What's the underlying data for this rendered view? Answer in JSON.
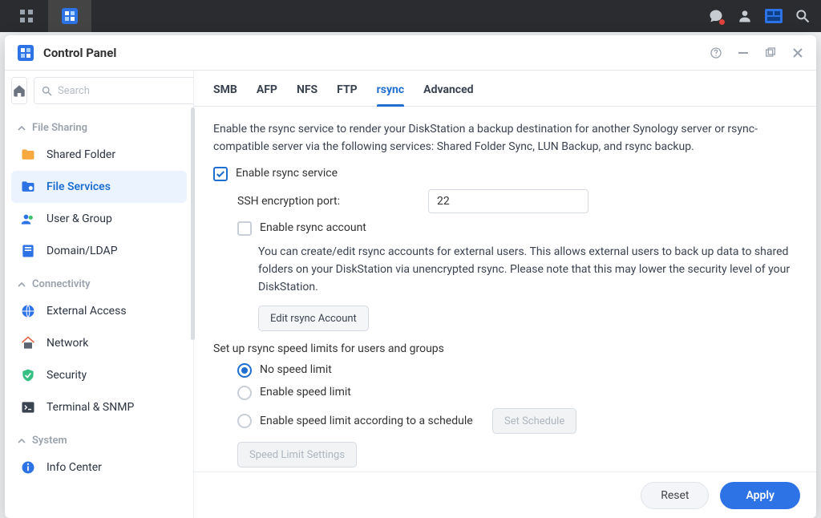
{
  "taskbar": {
    "left_items": [
      "apps-grid",
      "control-panel-task"
    ]
  },
  "window": {
    "title": "Control Panel"
  },
  "sidebar": {
    "search_placeholder": "Search",
    "groups": [
      {
        "label": "File Sharing",
        "items": [
          {
            "id": "shared-folder",
            "label": "Shared Folder"
          },
          {
            "id": "file-services",
            "label": "File Services"
          },
          {
            "id": "user-group",
            "label": "User & Group"
          },
          {
            "id": "domain-ldap",
            "label": "Domain/LDAP"
          }
        ]
      },
      {
        "label": "Connectivity",
        "items": [
          {
            "id": "external-access",
            "label": "External Access"
          },
          {
            "id": "network",
            "label": "Network"
          },
          {
            "id": "security",
            "label": "Security"
          },
          {
            "id": "terminal-snmp",
            "label": "Terminal & SNMP"
          }
        ]
      },
      {
        "label": "System",
        "items": [
          {
            "id": "info-center",
            "label": "Info Center"
          }
        ]
      }
    ],
    "active_item": "file-services"
  },
  "tabs": {
    "items": [
      "SMB",
      "AFP",
      "NFS",
      "FTP",
      "rsync",
      "Advanced"
    ],
    "active": "rsync"
  },
  "rsync": {
    "description": "Enable the rsync service to render your DiskStation a backup destination for another Synology server or rsync-compatible server via the following services: Shared Folder Sync, LUN Backup, and rsync backup.",
    "enable_service_label": "Enable rsync service",
    "enable_service_checked": true,
    "ssh_port_label": "SSH encryption port:",
    "ssh_port_value": "22",
    "enable_account_label": "Enable rsync account",
    "enable_account_checked": false,
    "account_help": "You can create/edit rsync accounts for external users. This allows external users to back up data to shared folders on your DiskStation via unencrypted rsync. Please note that this may lower the security level of your DiskStation.",
    "edit_account_label": "Edit rsync Account",
    "speed_section_label": "Set up rsync speed limits for users and groups",
    "radio_no_limit": "No speed limit",
    "radio_enable_limit": "Enable speed limit",
    "radio_schedule_limit": "Enable speed limit according to a schedule",
    "set_schedule_label": "Set Schedule",
    "speed_settings_label": "Speed Limit Settings",
    "selected_radio": "no_limit"
  },
  "footer": {
    "reset": "Reset",
    "apply": "Apply"
  },
  "colors": {
    "accent": "#1f6fd1",
    "primary_btn": "#2d73e6"
  }
}
